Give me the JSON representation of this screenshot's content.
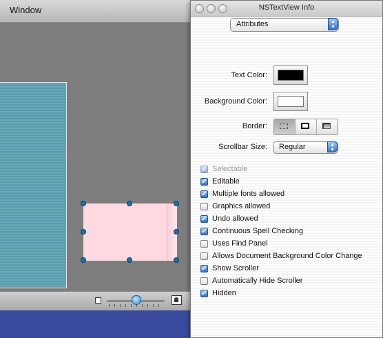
{
  "background_window": {
    "title": "Window"
  },
  "inspector": {
    "title": "NSTextView Info",
    "pane_selector": "Attributes",
    "text_color_label": "Text Color:",
    "text_color": "#000000",
    "background_color_label": "Background Color:",
    "background_color": "#ffffff",
    "border_label": "Border:",
    "border_options": [
      "none",
      "line",
      "bezel"
    ],
    "border_selected": "none",
    "scrollbar_size_label": "Scrollbar Size:",
    "scrollbar_size_value": "Regular",
    "checkboxes": [
      {
        "label": "Selectable",
        "checked": true,
        "enabled": false
      },
      {
        "label": "Editable",
        "checked": true,
        "enabled": true
      },
      {
        "label": "Multiple fonts allowed",
        "checked": true,
        "enabled": true
      },
      {
        "label": "Graphics allowed",
        "checked": false,
        "enabled": true
      },
      {
        "label": "Undo allowed",
        "checked": true,
        "enabled": true
      },
      {
        "label": "Continuous Spell Checking",
        "checked": true,
        "enabled": true
      },
      {
        "label": "Uses Find Panel",
        "checked": false,
        "enabled": true
      },
      {
        "label": "Allows Document Background Color Change",
        "checked": false,
        "enabled": true
      },
      {
        "label": "Show Scroller",
        "checked": true,
        "enabled": true
      },
      {
        "label": "Automatically Hide Scroller",
        "checked": false,
        "enabled": true
      },
      {
        "label": "Hidden",
        "checked": true,
        "enabled": true
      }
    ]
  },
  "icons": {
    "zoom_small": "zoom-out-icon",
    "zoom_large": "zoom-in-icon",
    "check": "✓",
    "popup_arrows": "▲▼"
  },
  "colors": {
    "desktop": "#3a4a9c",
    "accent": "#2f74d4",
    "selection_handle": "#1f6fa8",
    "text_view_fill": "#ffd9e0"
  }
}
